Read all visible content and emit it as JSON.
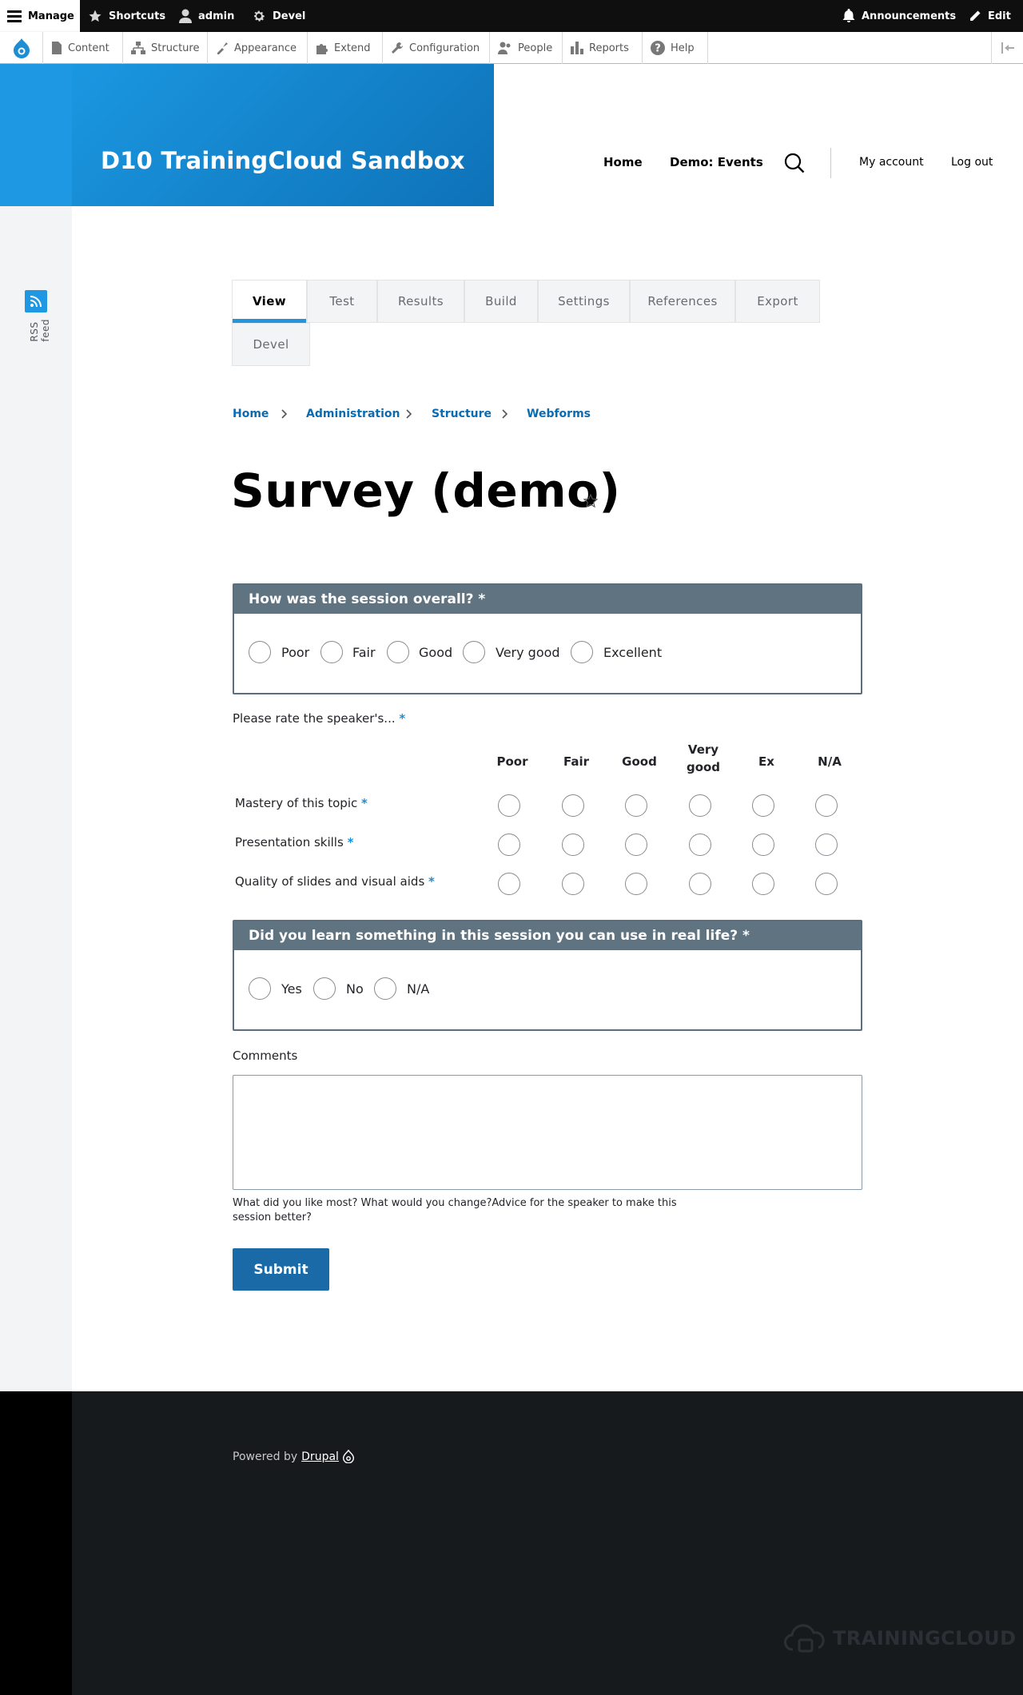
{
  "admin_toolbar": {
    "manage": "Manage",
    "shortcuts": "Shortcuts",
    "user": "admin",
    "devel": "Devel",
    "announcements": "Announcements",
    "edit": "Edit"
  },
  "admin_tray": {
    "items": [
      "Content",
      "Structure",
      "Appearance",
      "Extend",
      "Configuration",
      "People",
      "Reports",
      "Help"
    ]
  },
  "site": {
    "name": "D10 TrainingCloud Sandbox",
    "main_nav": [
      "Home",
      "Demo: Events"
    ],
    "account_nav": [
      "My account",
      "Log out"
    ]
  },
  "rss": {
    "label": "RSS feed"
  },
  "tabs": [
    "View",
    "Test",
    "Results",
    "Build",
    "Settings",
    "References",
    "Export",
    "Devel"
  ],
  "breadcrumb": [
    "Home",
    "Administration",
    "Structure",
    "Webforms"
  ],
  "page_title": "Survey (demo)",
  "q1": {
    "legend": "How was the session overall? *",
    "options": [
      "Poor",
      "Fair",
      "Good",
      "Very good",
      "Excellent"
    ]
  },
  "likert": {
    "label": "Please rate the speaker's...",
    "required": "*",
    "columns": [
      "Poor",
      "Fair",
      "Good",
      "Very good",
      "Ex",
      "N/A"
    ],
    "questions": [
      "Mastery of this topic",
      "Presentation skills",
      "Quality of slides and visual aids"
    ]
  },
  "q3": {
    "legend": "Did you learn something in this session you can use in real life? *",
    "options": [
      "Yes",
      "No",
      "N/A"
    ]
  },
  "comments": {
    "label": "Comments",
    "value": "",
    "description": "What did you like most? What would you change?Advice for the speaker to make this session better?"
  },
  "submit_label": "Submit",
  "footer": {
    "powered_by": "Powered by",
    "drupal_link": "Drupal",
    "logo_text": "TRAININGCLOUD"
  }
}
